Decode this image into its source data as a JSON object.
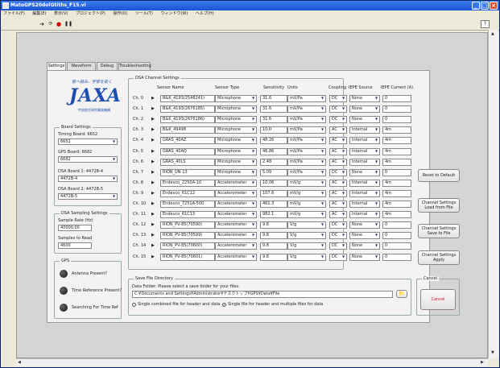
{
  "window": {
    "title": "MatoGPS20dolGtiths_F15.vi"
  },
  "menu": [
    "ファイル(F)",
    "編集(E)",
    "表示(V)",
    "プロジェクト(P)",
    "操作(O)",
    "ツール(T)",
    "ウィンドウ(W)",
    "ヘルプ(H)"
  ],
  "tabs": [
    "Settings",
    "Waveform",
    "Debug",
    "Troubleshooting"
  ],
  "logo": {
    "tagline": "宙へ挑み、宇宙を拓く",
    "name": "JAXA",
    "sub": "宇宙航空研究開発機構"
  },
  "board_settings": {
    "title": "Board Settings",
    "timing_label": "Timing Board: 6652",
    "timing_value": "6652",
    "gps_label": "GPS Board: 6682",
    "gps_value": "6682",
    "dsa1_label": "DSA Board 1: 4472B-4",
    "dsa1_value": "4472B-4",
    "dsa2_label": "DSA Board 2: 4472B-5",
    "dsa2_value": "4472B-5"
  },
  "sampling": {
    "title": "DSA Sampling Settings",
    "rate_label": "Sample Rate (Hz)",
    "rate_value": "40000.00",
    "samples_label": "Samples to Read",
    "samples_value": "4600"
  },
  "gps": {
    "title": "GPS",
    "indicators": [
      "Antenna Present?",
      "Time Reference Present?",
      "Searching For Time Ref"
    ]
  },
  "dsa_channels": {
    "title": "DSA Channel Settings",
    "headers": [
      "Sensor Name",
      "Sensor Type",
      "Sensitivity",
      "Units",
      "Coupling",
      "IEPE Source",
      "IEPE Current (A)"
    ],
    "rows": [
      {
        "ch": "Ch. 0",
        "name": "B&K_4193(2548241)",
        "type": "Microphone",
        "sens": "31.6",
        "units": "mV/Pa",
        "coupling": "DC",
        "iepe": "None",
        "current": "0"
      },
      {
        "ch": "Ch. 1",
        "name": "B&K_4193(2676185)",
        "type": "Microphone",
        "sens": "31.6",
        "units": "mV/Pa",
        "coupling": "DC",
        "iepe": "None",
        "current": "0"
      },
      {
        "ch": "Ch. 2",
        "name": "B&K_4193(2676186)",
        "type": "Microphone",
        "sens": "31.6",
        "units": "mV/Pa",
        "coupling": "DC",
        "iepe": "None",
        "current": "0"
      },
      {
        "ch": "Ch. 3",
        "name": "B&K_49498",
        "type": "Microphone",
        "sens": "10.0",
        "units": "mV/Pa",
        "coupling": "AC",
        "iepe": "Internal",
        "current": "4m"
      },
      {
        "ch": "Ch. 4",
        "name": "GRAS_40AZ",
        "type": "Microphone",
        "sens": "48.26",
        "units": "mV/Pa",
        "coupling": "AC",
        "iepe": "Internal",
        "current": "4m"
      },
      {
        "ch": "Ch. 5",
        "name": "GRAS_40AQ",
        "type": "Microphone",
        "sens": "46.86",
        "units": "mV/Pa",
        "coupling": "AC",
        "iepe": "Internal",
        "current": "4m"
      },
      {
        "ch": "Ch. 6",
        "name": "GRAS_40LS",
        "type": "Microphone",
        "sens": "2.48",
        "units": "mV/Pa",
        "coupling": "AC",
        "iepe": "Internal",
        "current": "4m"
      },
      {
        "ch": "Ch. 7",
        "name": "RION_UN-13",
        "type": "Microphone",
        "sens": "5.09",
        "units": "mV/Pa",
        "coupling": "DC",
        "iepe": "None",
        "current": "0"
      },
      {
        "ch": "Ch. 8",
        "name": "Endevco_2250A-10",
        "type": "Accelerometer",
        "sens": "10.06",
        "units": "mV/g",
        "coupling": "AC",
        "iepe": "Internal",
        "current": "4m"
      },
      {
        "ch": "Ch. 9",
        "name": "Endevco_61C12",
        "type": "Accelerometer",
        "sens": "107.6",
        "units": "mV/g",
        "coupling": "AC",
        "iepe": "Internal",
        "current": "4m"
      },
      {
        "ch": "Ch. 10",
        "name": "Endevco_7251A-500",
        "type": "Accelerometer",
        "sens": "461.3",
        "units": "mV/g",
        "coupling": "AC",
        "iepe": "Internal",
        "current": "4m"
      },
      {
        "ch": "Ch. 11",
        "name": "Endevco_61C13",
        "type": "Accelerometer",
        "sens": "982.1",
        "units": "mV/g",
        "coupling": "AC",
        "iepe": "Internal",
        "current": "4m"
      },
      {
        "ch": "Ch. 12",
        "name": "RION_PV-85(70590)",
        "type": "Accelerometer",
        "sens": "9.8",
        "units": "V/g",
        "coupling": "DC",
        "iepe": "None",
        "current": "0"
      },
      {
        "ch": "Ch. 13",
        "name": "RION_PV-85(70599)",
        "type": "Accelerometer",
        "sens": "9.8",
        "units": "V/g",
        "coupling": "DC",
        "iepe": "None",
        "current": "0"
      },
      {
        "ch": "Ch. 14",
        "name": "RION_PV-85(70600)",
        "type": "Accelerometer",
        "sens": "9.8",
        "units": "V/g",
        "coupling": "DC",
        "iepe": "None",
        "current": "0"
      },
      {
        "ch": "Ch. 15",
        "name": "RION_PV-85(70601)",
        "type": "Accelerometer",
        "sens": "9.8",
        "units": "V/g",
        "coupling": "DC",
        "iepe": "None",
        "current": "0"
      }
    ]
  },
  "buttons": {
    "reset": "Reset to Default",
    "load": "Channel Settings Load from File",
    "save": "Channel Settings Save to File",
    "apply": "Channel Settings Apply",
    "cancel": "Cancel"
  },
  "cancel_group": {
    "title": "Cancel"
  },
  "save_file": {
    "title": "Save File Directory",
    "prompt": "Data Folder: Please select a save folder for your files.",
    "path": "C:¥Documents and Settings¥Administrator¥デスクトップ¥GPS¥Data¥File",
    "opt1": "Single combined file for header and data",
    "opt2": "Single file for header and multiple files for data"
  },
  "colors": {
    "accent": "#1e4fb0",
    "cancel_text": "#c8102e",
    "title_bar": "#1a55d4"
  }
}
